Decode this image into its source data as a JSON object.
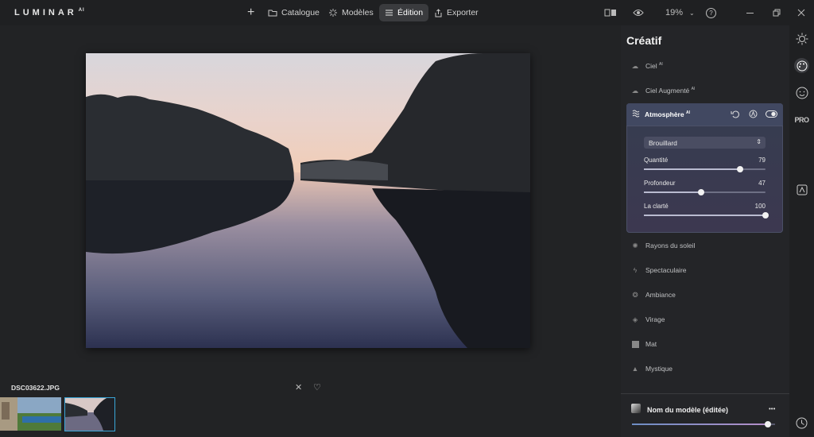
{
  "app": {
    "logo": "LUMINAR",
    "logo_suffix": "AI"
  },
  "topnav": {
    "add": "+",
    "catalogue": "Catalogue",
    "modeles": "Modèles",
    "edition": "Édition",
    "exporter": "Exporter"
  },
  "topright": {
    "zoom": "19%",
    "help": "?"
  },
  "photo": {
    "filename": "DSC03622.JPG"
  },
  "panel": {
    "title": "Créatif",
    "tools_top": [
      {
        "label": "Ciel",
        "sup": "AI"
      },
      {
        "label": "Ciel Augmenté",
        "sup": "AI"
      }
    ],
    "atmosphere": {
      "title": "Atmosphère",
      "sup": "AI",
      "mode": "Brouillard",
      "sliders": [
        {
          "label": "Quantité",
          "value": 79
        },
        {
          "label": "Profondeur",
          "value": 47
        },
        {
          "label": "La clarté",
          "value": 100
        }
      ]
    },
    "tools_bottom": [
      {
        "label": "Rayons du soleil"
      },
      {
        "label": "Spectaculaire"
      },
      {
        "label": "Ambiance"
      },
      {
        "label": "Virage"
      },
      {
        "label": "Mat"
      },
      {
        "label": "Mystique"
      }
    ],
    "footer": {
      "preset": "Nom du modèle (éditée)",
      "more": "•••",
      "amount": 0.95
    }
  },
  "sidebar": {
    "pro": "PRO"
  }
}
